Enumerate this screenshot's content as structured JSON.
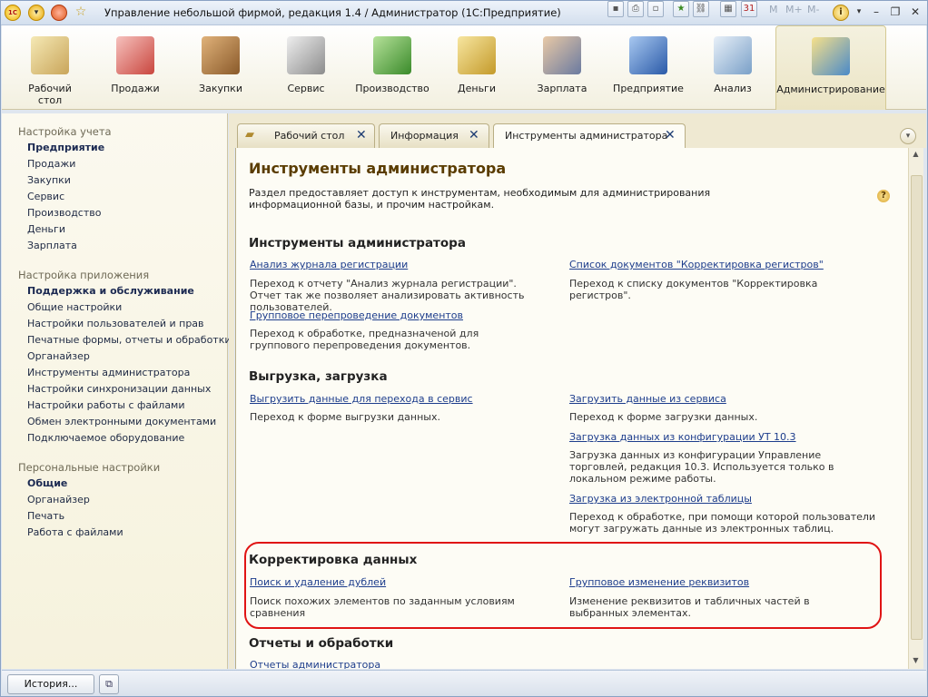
{
  "window": {
    "title": "Управление небольшой фирмой, редакция 1.4 / Администратор  (1С:Предприятие)",
    "toolbar_m": [
      "M",
      "M+",
      "M-"
    ]
  },
  "sections": [
    {
      "label": "Рабочий стол",
      "icon": "desktop-icon"
    },
    {
      "label": "Продажи",
      "icon": "basket-icon"
    },
    {
      "label": "Закупки",
      "icon": "boxes-icon"
    },
    {
      "label": "Сервис",
      "icon": "tools-icon"
    },
    {
      "label": "Производство",
      "icon": "factory-icon"
    },
    {
      "label": "Деньги",
      "icon": "money-icon"
    },
    {
      "label": "Зарплата",
      "icon": "worker-icon"
    },
    {
      "label": "Предприятие",
      "icon": "building-icon"
    },
    {
      "label": "Анализ",
      "icon": "chart-icon"
    },
    {
      "label": "Администрирование",
      "icon": "admin-icon"
    }
  ],
  "sidebar": {
    "groups": [
      {
        "title": "Настройка учета",
        "items": [
          "Предприятие",
          "Продажи",
          "Закупки",
          "Сервис",
          "Производство",
          "Деньги",
          "Зарплата"
        ]
      },
      {
        "title": "Настройка приложения",
        "items": [
          "Поддержка и обслуживание",
          "Общие настройки",
          "Настройки пользователей и прав",
          "Печатные формы, отчеты и обработки",
          "Органайзер",
          "Инструменты администратора",
          "Настройки синхронизации данных",
          "Настройки работы с файлами",
          "Обмен электронными документами",
          "Подключаемое оборудование"
        ]
      },
      {
        "title": "Персональные настройки",
        "items": [
          "Общие",
          "Органайзер",
          "Печать",
          "Работа с файлами"
        ]
      }
    ]
  },
  "tabs": [
    {
      "label": "Рабочий стол"
    },
    {
      "label": "Информация"
    },
    {
      "label": "Инструменты администратора"
    }
  ],
  "page": {
    "title": "Инструменты администратора",
    "description": "Раздел предоставляет доступ к инструментам, необходимым для администрирования информационной базы, и прочим настройкам.",
    "help": "?",
    "sections": {
      "tools": {
        "heading": "Инструменты администратора",
        "left": [
          {
            "link": "Анализ журнала регистрации",
            "desc": "Переход к отчету \"Анализ журнала регистрации\". Отчет так же позволяет анализировать активность пользователей."
          },
          {
            "link": "Групповое перепроведение документов",
            "desc": "Переход к обработке, предназначеной для группового перепроведения документов."
          }
        ],
        "right": [
          {
            "link": "Список документов \"Корректировка регистров\"",
            "desc": "Переход к списку документов \"Корректировка регистров\"."
          }
        ]
      },
      "export": {
        "heading": "Выгрузка, загрузка",
        "left": [
          {
            "link": "Выгрузить данные для перехода в сервис",
            "desc": "Переход к форме выгрузки данных."
          }
        ],
        "right": [
          {
            "link": "Загрузить данные из сервиса",
            "desc": "Переход к форме загрузки данных."
          },
          {
            "link": "Загрузка данных из конфигурации УТ 10.3",
            "desc": "Загрузка данных из конфигурации Управление торговлей, редакция 10.3. Используется только в локальном режиме работы."
          },
          {
            "link": "Загрузка из электронной таблицы",
            "desc": "Переход к обработке, при помощи которой пользователи могут загружать данные из электронных таблиц."
          }
        ]
      },
      "correction": {
        "heading": "Корректировка данных",
        "left": [
          {
            "link": "Поиск и удаление дублей",
            "desc": "Поиск похожих элементов по заданным условиям сравнения"
          }
        ],
        "right": [
          {
            "link": "Групповое изменение реквизитов",
            "desc": "Изменение реквизитов и табличных частей в выбранных элементах."
          }
        ]
      },
      "reports": {
        "heading": "Отчеты и обработки",
        "left": [
          {
            "link": "Отчеты администратора"
          }
        ]
      }
    }
  },
  "bottom": {
    "history_label": "История..."
  }
}
